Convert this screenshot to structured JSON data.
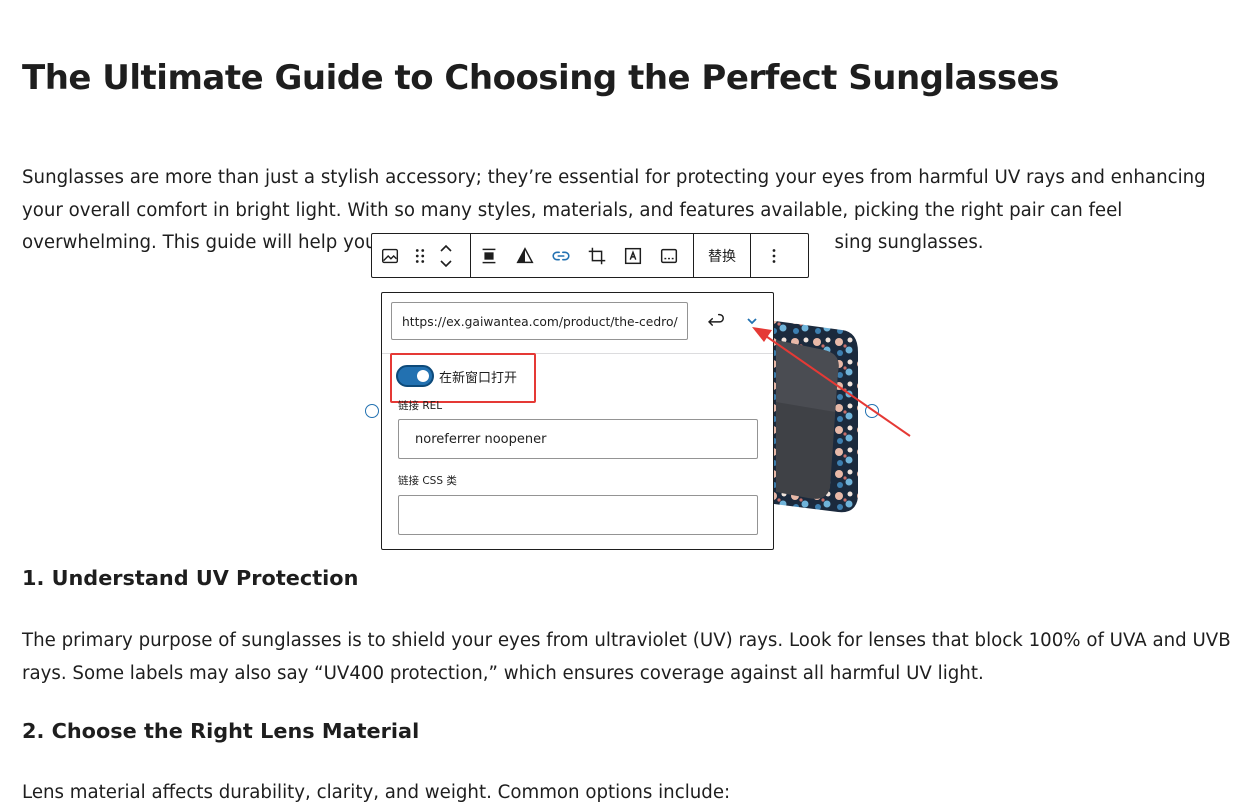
{
  "article": {
    "title": "The Ultimate Guide to Choosing the Perfect Sunglasses",
    "intro_line1": "Sunglasses are more than just a stylish accessory; they’re essential for protecting your eyes from harmful UV rays and enhancing",
    "intro_line2": "your overall comfort in bright light. With so many styles, materials, and features available, picking the right pair can feel",
    "intro_line3_start": "overwhelming. This guide will help you",
    "intro_line3_end": "sing sunglasses.",
    "section1_heading": "1. Understand UV Protection",
    "section1_text": "The primary purpose of sunglasses is to shield your eyes from ultraviolet (UV) rays. Look for lenses that block 100% of UVA and UVB rays. Some labels may also say “UV400 protection,” which ensures coverage against all harmful UV light.",
    "section2_heading": "2. Choose the Right Lens Material",
    "section2_text": "Lens material affects durability, clarity, and weight. Common options include:"
  },
  "toolbar": {
    "replace_label": "替换",
    "icons": [
      "image-block-icon",
      "drag-handle-icon",
      "move-up-icon",
      "move-down-icon",
      "align-icon",
      "duotone-filter-icon",
      "link-icon",
      "crop-icon",
      "text-over-image-icon",
      "caption-icon",
      "more-options-icon"
    ]
  },
  "link_popover": {
    "url_value": "https://ex.gaiwantea.com/product/the-cedro/",
    "open_new_tab_label": "在新窗口打开",
    "open_new_tab_on": true,
    "rel_label": "链接 REL",
    "rel_value": "noreferrer noopener",
    "css_class_label": "链接 CSS 类",
    "css_class_value": ""
  },
  "colors": {
    "accent": "#2271b1",
    "annotation": "#e53935",
    "text": "#1e1e1e"
  }
}
